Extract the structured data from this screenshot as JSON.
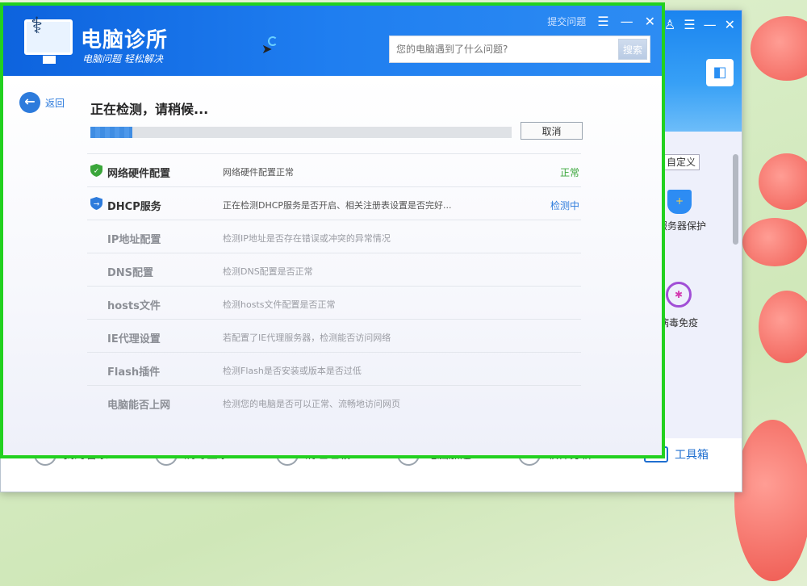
{
  "background_app": {
    "custom_label": "自定义",
    "tools": [
      {
        "label": "服务器保护",
        "icon": "shield-icon"
      },
      {
        "label": "病毒免疫",
        "icon": "virus-target-icon"
      }
    ],
    "nav": [
      {
        "label": "我的管家",
        "icon": "user-icon"
      },
      {
        "label": "病毒查杀",
        "icon": "lightning-icon"
      },
      {
        "label": "清理垃圾",
        "icon": "broom-icon"
      },
      {
        "label": "电脑加速",
        "icon": "rocket-icon"
      },
      {
        "label": "软件分析",
        "icon": "chart-icon"
      },
      {
        "label": "工具箱",
        "icon": "toolbox-icon"
      }
    ]
  },
  "dialog": {
    "title": "电脑诊所",
    "subtitle": "电脑问题 轻松解决",
    "feedback_label": "提交问题",
    "menu_icon": "menu-icon",
    "search": {
      "placeholder": "您的电脑遇到了什么问题?",
      "button": "搜索"
    },
    "back_label": "返回",
    "status": "正在检测，请稍候...",
    "progress": 0.1,
    "cancel_label": "取消",
    "colors": {
      "ok": "#3aa63a",
      "checking": "#2d7bdc",
      "header": "#1f7ef0",
      "frame": "#22d11f"
    },
    "items": [
      {
        "name": "网络硬件配置",
        "desc": "网络硬件配置正常",
        "state": "正常",
        "status": "ok",
        "icon": "check-shield-icon"
      },
      {
        "name": "DHCP服务",
        "desc": "正在检测DHCP服务是否开启、相关注册表设置是否完好...",
        "state": "检测中",
        "status": "checking",
        "icon": "arrow-shield-icon"
      },
      {
        "name": "IP地址配置",
        "desc": "检测IP地址是否存在错误或冲突的异常情况",
        "state": "",
        "status": "pending"
      },
      {
        "name": "DNS配置",
        "desc": "检测DNS配置是否正常",
        "state": "",
        "status": "pending"
      },
      {
        "name": "hosts文件",
        "desc": "检测hosts文件配置是否正常",
        "state": "",
        "status": "pending"
      },
      {
        "name": "IE代理设置",
        "desc": "若配置了IE代理服务器，检测能否访问网络",
        "state": "",
        "status": "pending"
      },
      {
        "name": "Flash插件",
        "desc": "检测Flash是否安装或版本是否过低",
        "state": "",
        "status": "pending"
      },
      {
        "name": "电脑能否上网",
        "desc": "检测您的电脑是否可以正常、流畅地访问网页",
        "state": "",
        "status": "pending"
      }
    ]
  }
}
